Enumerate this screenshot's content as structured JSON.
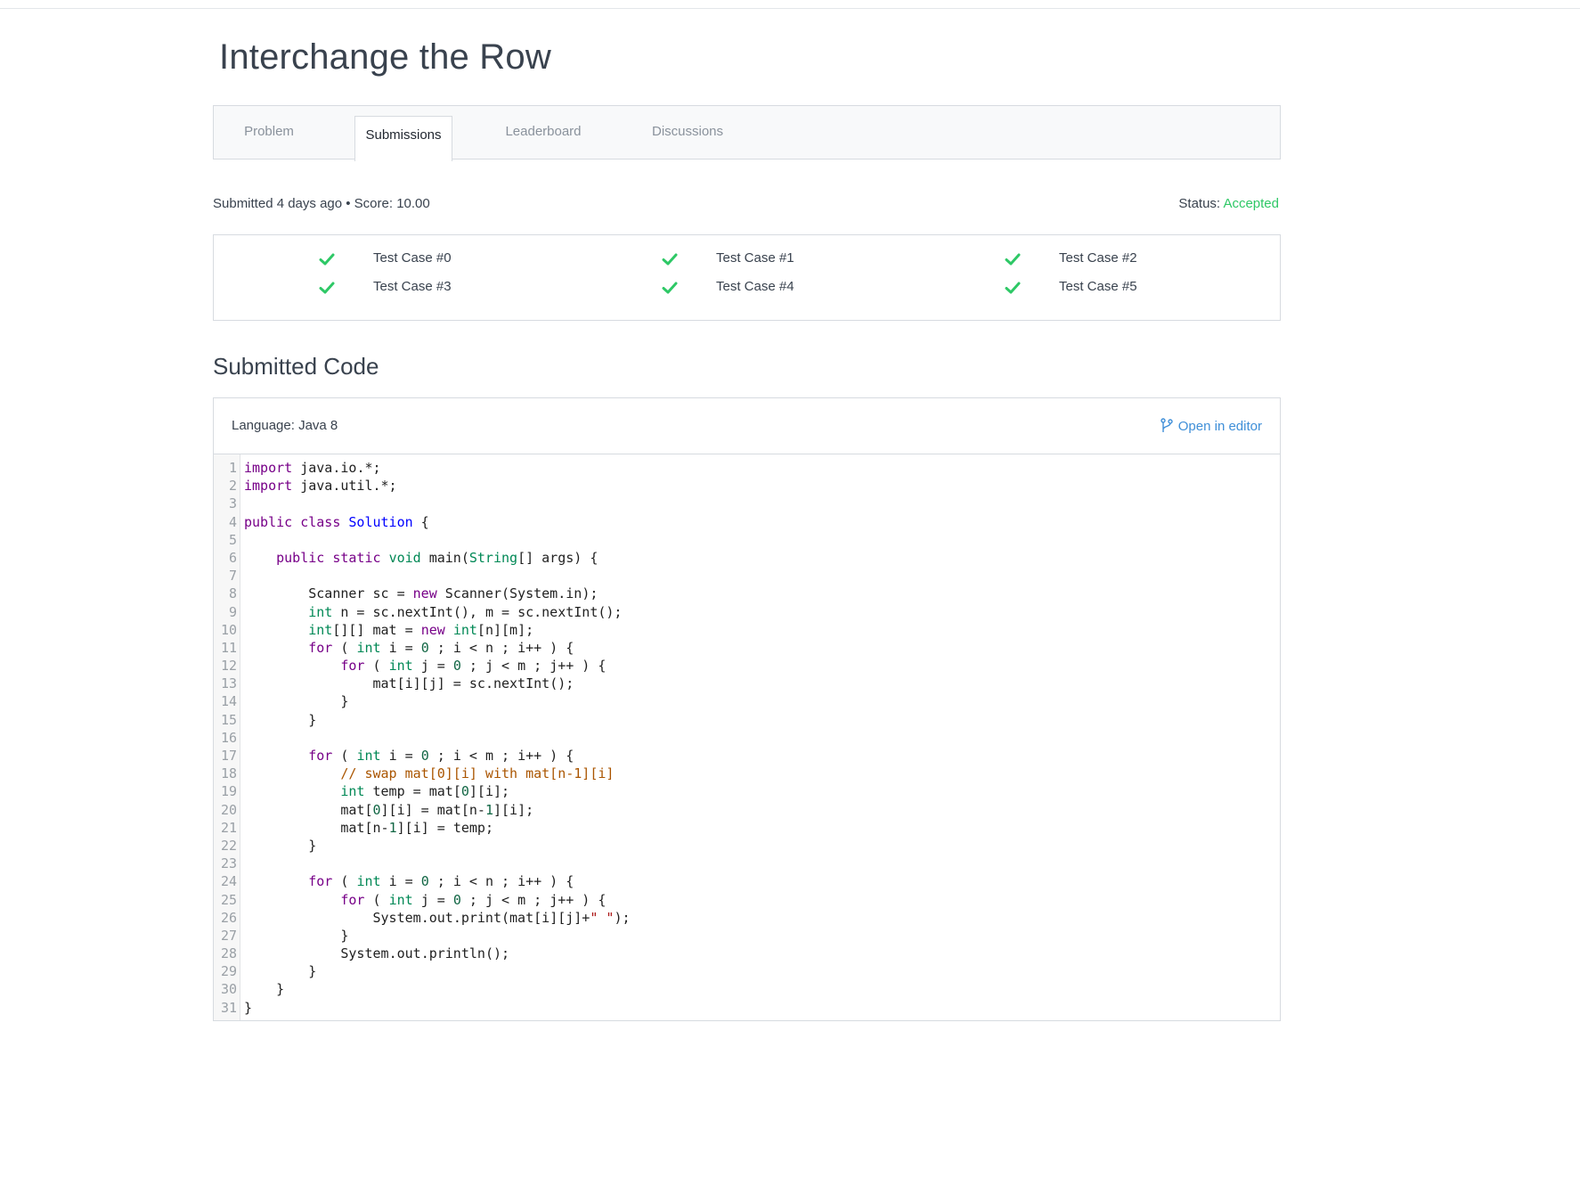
{
  "page": {
    "title": "Interchange the Row"
  },
  "tabs": [
    {
      "label": "Problem",
      "active": false
    },
    {
      "label": "Submissions",
      "active": true
    },
    {
      "label": "Leaderboard",
      "active": false
    },
    {
      "label": "Discussions",
      "active": false
    }
  ],
  "submission": {
    "info": "Submitted 4 days ago • Score: 10.00",
    "status_label": "Status:",
    "status_value": "Accepted"
  },
  "test_cases": [
    {
      "label": "Test Case #0",
      "passed": true
    },
    {
      "label": "Test Case #1",
      "passed": true
    },
    {
      "label": "Test Case #2",
      "passed": true
    },
    {
      "label": "Test Case #3",
      "passed": true
    },
    {
      "label": "Test Case #4",
      "passed": true
    },
    {
      "label": "Test Case #5",
      "passed": true
    }
  ],
  "code_section": {
    "title": "Submitted Code",
    "language": "Language: Java 8",
    "open_in_editor": "Open in editor",
    "lines": [
      "import java.io.*;",
      "import java.util.*;",
      "",
      "public class Solution {",
      "",
      "    public static void main(String[] args) {",
      "",
      "        Scanner sc = new Scanner(System.in);",
      "        int n = sc.nextInt(), m = sc.nextInt();",
      "        int[][] mat = new int[n][m];",
      "        for ( int i = 0 ; i < n ; i++ ) {",
      "            for ( int j = 0 ; j < m ; j++ ) {",
      "                mat[i][j] = sc.nextInt();",
      "            }",
      "        }",
      "",
      "        for ( int i = 0 ; i < m ; i++ ) {",
      "            // swap mat[0][i] with mat[n-1][i]",
      "            int temp = mat[0][i];",
      "            mat[0][i] = mat[n-1][i];",
      "            mat[n-1][i] = temp;",
      "        }",
      "",
      "        for ( int i = 0 ; i < n ; i++ ) {",
      "            for ( int j = 0 ; j < m ; j++ ) {",
      "                System.out.print(mat[i][j]+\" \");",
      "            }",
      "            System.out.println();",
      "        }",
      "    }",
      "}"
    ]
  },
  "colors": {
    "accepted": "#2ec866",
    "check": "#2ec866",
    "link": "#3f8fd8"
  },
  "icons": {
    "test_passed": "check-icon",
    "open_in_editor": "branch-icon"
  }
}
